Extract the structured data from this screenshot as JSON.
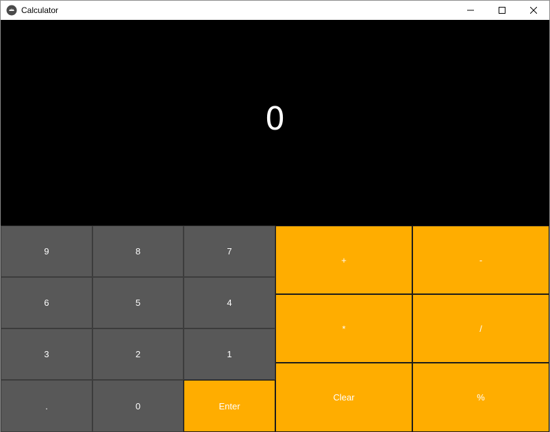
{
  "window": {
    "title": "Calculator",
    "app_icon": "kivy-logo-icon",
    "controls": {
      "minimize_icon": "minimize-icon",
      "maximize_icon": "maximize-icon",
      "close_icon": "close-icon"
    }
  },
  "display": {
    "value": "0"
  },
  "keypad": {
    "number_keys": {
      "k9": "9",
      "k8": "8",
      "k7": "7",
      "k6": "6",
      "k5": "5",
      "k4": "4",
      "k3": "3",
      "k2": "2",
      "k1": "1",
      "dot": ".",
      "k0": "0"
    },
    "operator_keys": {
      "enter": "Enter",
      "plus": "+",
      "minus": "-",
      "multiply": "*",
      "divide": "/",
      "clear": "Clear",
      "percent": "%"
    }
  },
  "colors": {
    "display_bg": "#000000",
    "number_key_bg": "#585858",
    "operator_key_bg": "#ffad00",
    "key_text": "#ffffff"
  }
}
